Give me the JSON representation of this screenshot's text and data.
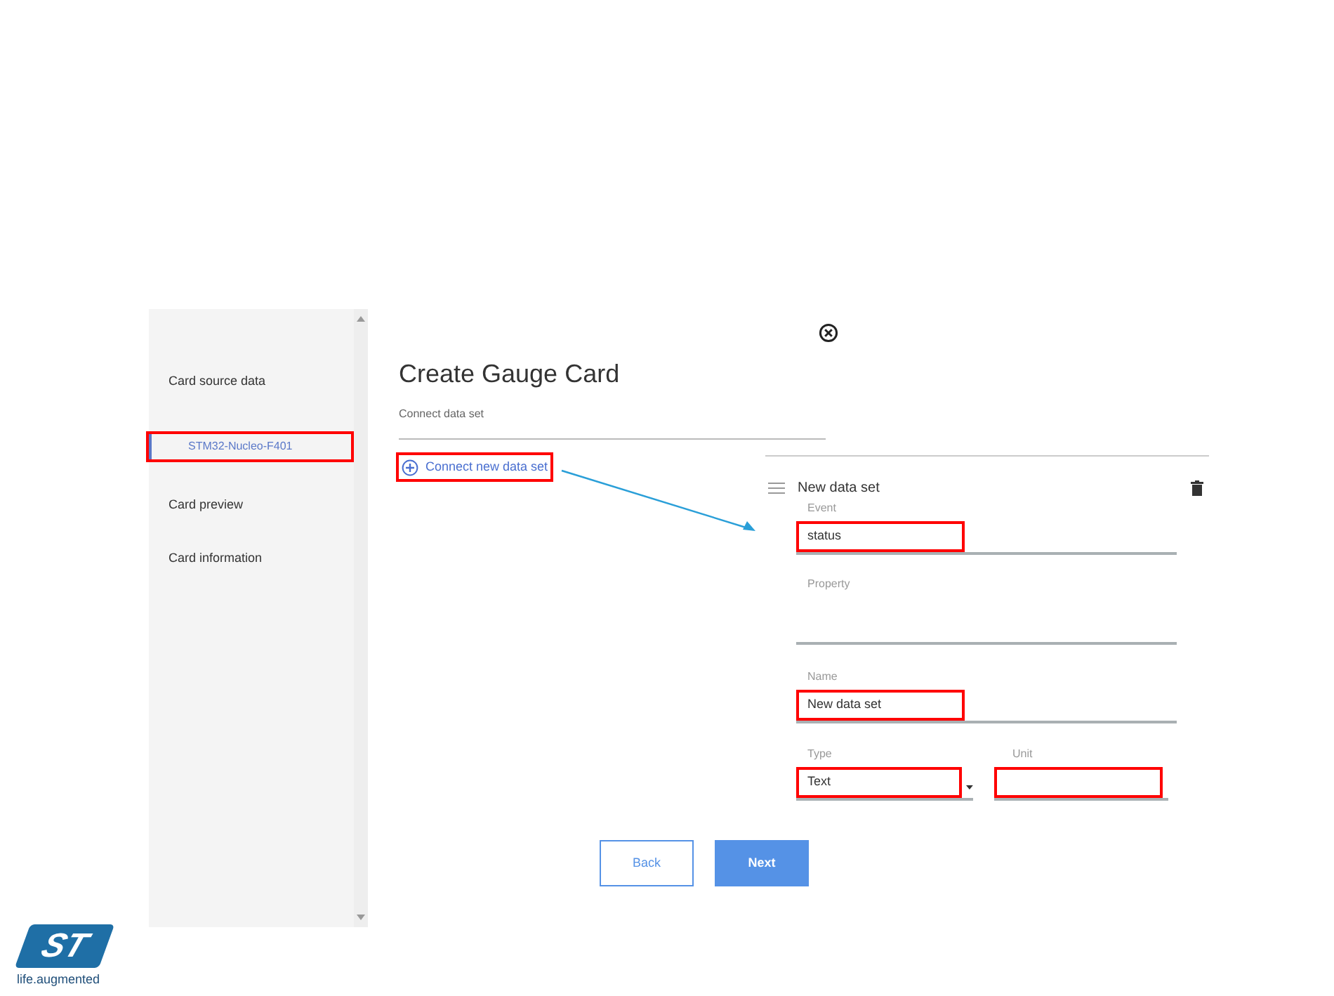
{
  "sidebar": {
    "items": [
      {
        "label": "Card source data",
        "kind": "section",
        "highlighted": false
      },
      {
        "label": "STM32-Nucleo-F401",
        "kind": "device",
        "highlighted": true
      },
      {
        "label": "Card preview",
        "kind": "section",
        "highlighted": false
      },
      {
        "label": "Card information",
        "kind": "section",
        "highlighted": false
      }
    ]
  },
  "dialog": {
    "title": "Create Gauge Card",
    "section_label": "Connect data set",
    "connect_button": {
      "label": "Connect new data set",
      "highlighted": true
    },
    "data_set": {
      "title": "New data set",
      "fields": [
        {
          "label": "Event",
          "value": "status",
          "highlighted": true
        },
        {
          "label": "Property",
          "highlighted": false
        },
        {
          "label": "Name",
          "value": "New data set",
          "highlighted": true
        }
      ],
      "row": [
        {
          "label": "Type",
          "value": "Text",
          "dropdown": true,
          "highlighted": true
        },
        {
          "label": "Unit",
          "highlighted": true
        }
      ]
    },
    "buttons": [
      {
        "label": "Back",
        "kind": "secondary"
      },
      {
        "label": "Next",
        "kind": "primary"
      }
    ]
  },
  "logo": {
    "mark": "ST",
    "tagline": "life.augmented"
  }
}
